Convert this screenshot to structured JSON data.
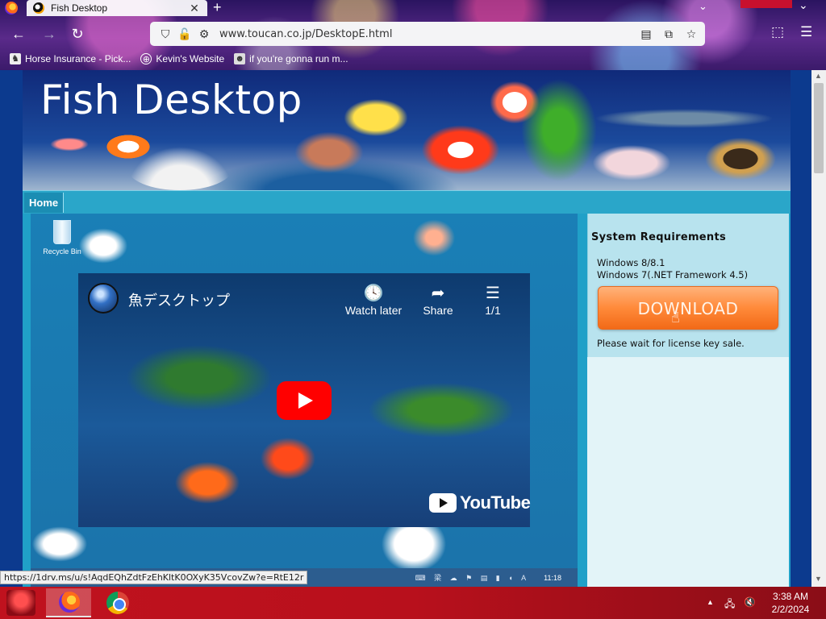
{
  "browser": {
    "tab_title": "Fish Desktop",
    "tab_close": "✕",
    "new_tab": "+",
    "url": "www.toucan.co.jp/DesktopE.html",
    "bookmarks": [
      {
        "label": "Horse Insurance - Pick...",
        "icon": "horse-icon"
      },
      {
        "label": "Kevin's Website",
        "icon": "globe-icon"
      },
      {
        "label": "if you're gonna run m...",
        "icon": "raccoon-icon"
      }
    ]
  },
  "site": {
    "title": "Fish Desktop",
    "nav": {
      "home": "Home"
    }
  },
  "desktop_preview": {
    "recycle_bin_label": "Recycle Bin",
    "inner_time": "11:18",
    "inner_tray": "⌨ 梁 ☁ ⚑ ▤ ▮ ◖ A"
  },
  "video": {
    "title": "魚デスクトップ",
    "watch_later": "Watch later",
    "share": "Share",
    "playlist": "1/1",
    "youtube_label": "YouTube"
  },
  "sidebar": {
    "requirements_title": "System Requirements",
    "requirements": [
      "Windows 8/8.1",
      "Windows 7(.NET Framework 4.5)"
    ],
    "download_label": "DOWNLOAD",
    "wait_note": "Please wait for license key sale."
  },
  "status_bar_link": "https://1drv.ms/u/s!AqdEQhZdtFzEhKltK0OXyK35VcovZw?e=RtE12r",
  "taskbar": {
    "time": "3:38 AM",
    "date": "2/2/2024"
  },
  "colors": {
    "download_button": "#ff8a3a",
    "youtube_red": "#ff0000",
    "taskbar": "#c0121e",
    "page_background": "#0c3a8e",
    "nav_bar": "#2aa6c9"
  }
}
